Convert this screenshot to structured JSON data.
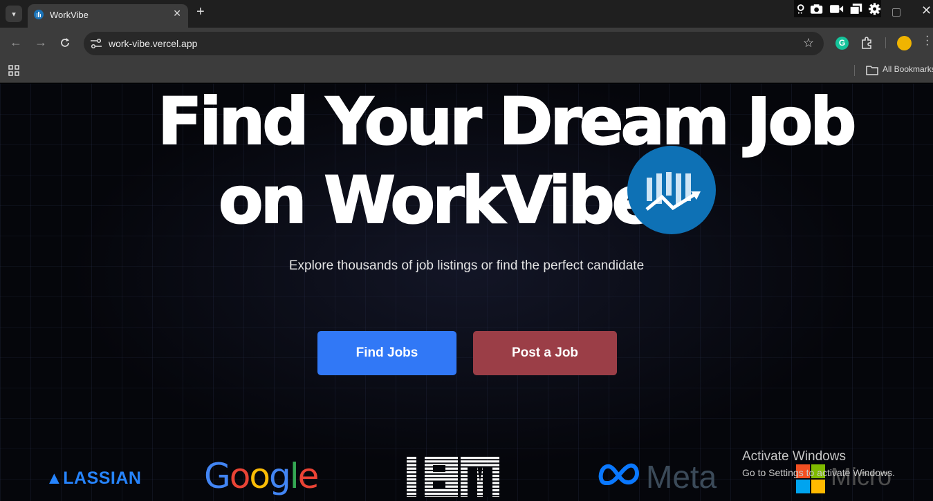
{
  "browser": {
    "tab": {
      "title": "WorkVibe"
    },
    "omnibox": {
      "url": "work-vibe.vercel.app"
    },
    "bookmarks": {
      "all_label": "All Bookmarks"
    }
  },
  "hero": {
    "line1": "Find Your Dream Job",
    "line2": "on WorkVibe",
    "subtitle": "Explore thousands of job listings or find the perfect candidate",
    "find_jobs_label": "Find Jobs",
    "post_job_label": "Post a Job"
  },
  "logos": {
    "atlassian": "LASSIAN",
    "google": [
      "G",
      "o",
      "o",
      "g",
      "l",
      "e"
    ],
    "ibm": "IBM",
    "meta": "Meta",
    "microsoft": "Micro"
  },
  "watermark": {
    "title": "Activate Windows",
    "subtitle": "Go to Settings to activate Windows."
  },
  "colors": {
    "find_button": "#3178f6",
    "post_button": "#9b3e47",
    "logo_blue": "#0e71b5",
    "google": [
      "#4285f4",
      "#ea4335",
      "#fbbc05",
      "#4285f4",
      "#34a853",
      "#ea4335"
    ]
  },
  "icons": [
    "tab-search-icon",
    "favicon-icon",
    "close-icon",
    "plus-icon",
    "back-icon",
    "forward-icon",
    "reload-icon",
    "site-info-icon",
    "star-icon",
    "grammarly-icon",
    "extensions-icon",
    "profile-avatar",
    "apps-icon",
    "folder-icon",
    "workvibe-logo-icon",
    "meta-infinity-icon",
    "windows-logo-icon"
  ]
}
